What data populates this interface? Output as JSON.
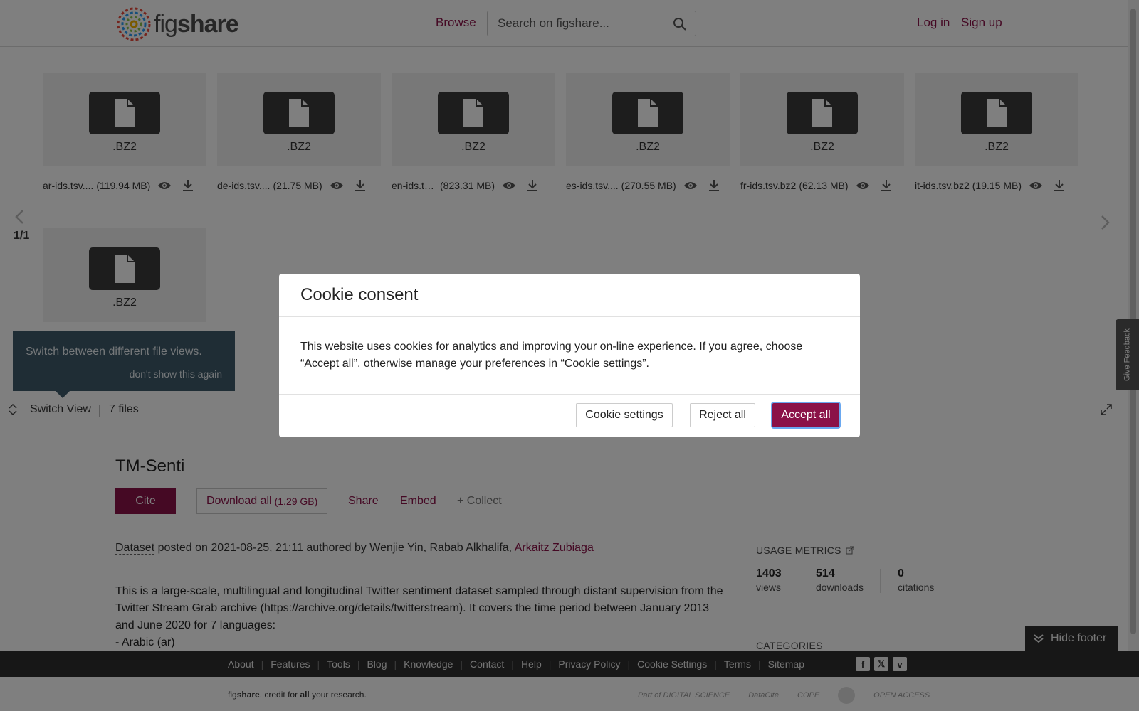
{
  "header": {
    "logo_prefix": "fig",
    "logo_suffix": "share",
    "browse": "Browse",
    "search_placeholder": "Search on figshare...",
    "login": "Log in",
    "signup": "Sign up"
  },
  "colors": {
    "brand": "#8b1248",
    "dark": "#2f2f2f",
    "tip": "#3f5a6a"
  },
  "viewer": {
    "files": [
      {
        "ext": ".BZ2",
        "name": "ar-ids.tsv....",
        "size": "(119.94 MB)"
      },
      {
        "ext": ".BZ2",
        "name": "de-ids.tsv....",
        "size": "(21.75 MB)"
      },
      {
        "ext": ".BZ2",
        "name": "en-ids.tsv...",
        "size": "(823.31 MB)"
      },
      {
        "ext": ".BZ2",
        "name": "es-ids.tsv....",
        "size": "(270.55 MB)"
      },
      {
        "ext": ".BZ2",
        "name": "fr-ids.tsv.bz2",
        "size": "(62.13 MB)"
      },
      {
        "ext": ".BZ2",
        "name": "it-ids.tsv.bz2",
        "size": "(19.15 MB)"
      },
      {
        "ext": ".BZ2",
        "name": "",
        "size": ""
      }
    ],
    "pager": "1/1",
    "tip_text": "Switch between different file views.",
    "tip_dismiss": "don't show this again",
    "switch_view": "Switch View",
    "files_count": "7 files"
  },
  "item": {
    "title": "TM-Senti",
    "cite": "Cite",
    "download_all": "Download all",
    "download_size": "(1.29 GB)",
    "share": "Share",
    "embed": "Embed",
    "collect": "+ Collect",
    "posted_type": "Dataset",
    "posted_text": " posted on 2021-08-25, 21:11 authored by Wenjie Yin, Rabab Alkhalifa, ",
    "author_link": "Arkaitz Zubiaga",
    "description": [
      "This is a large-scale, multilingual and longitudinal Twitter sentiment dataset sampled through distant supervision from the Twitter Stream Grab archive (https://archive.org/details/twitterstream). It covers the time period between January 2013 and June 2020 for 7 languages:",
      "- Arabic (ar)"
    ]
  },
  "metrics": {
    "title": "USAGE METRICS",
    "items": [
      {
        "num": "1403",
        "label": "views"
      },
      {
        "num": "514",
        "label": "downloads"
      },
      {
        "num": "0",
        "label": "citations"
      }
    ],
    "categories": "CATEGORIES"
  },
  "footer": {
    "links": [
      "About",
      "Features",
      "Tools",
      "Blog",
      "Knowledge",
      "Contact",
      "Help",
      "Privacy Policy",
      "Cookie Settings",
      "Terms",
      "Sitemap"
    ],
    "credit_fig": "fig",
    "credit_share": "share",
    "credit_mid": ". credit for ",
    "credit_all": "all",
    "credit_end": " your research.",
    "partners": [
      "Part of DIGITAL SCIENCE",
      "DataCite",
      "COPE",
      "",
      "OPEN ACCESS"
    ],
    "hide_footer": "Hide footer",
    "feedback": "Give Feedback"
  },
  "cookie": {
    "title": "Cookie consent",
    "body": "This website uses cookies for analytics and improving your on-line experience. If you agree, choose “Accept all”, otherwise manage your preferences in “Cookie settings”.",
    "settings": "Cookie settings",
    "reject": "Reject all",
    "accept": "Accept all"
  }
}
